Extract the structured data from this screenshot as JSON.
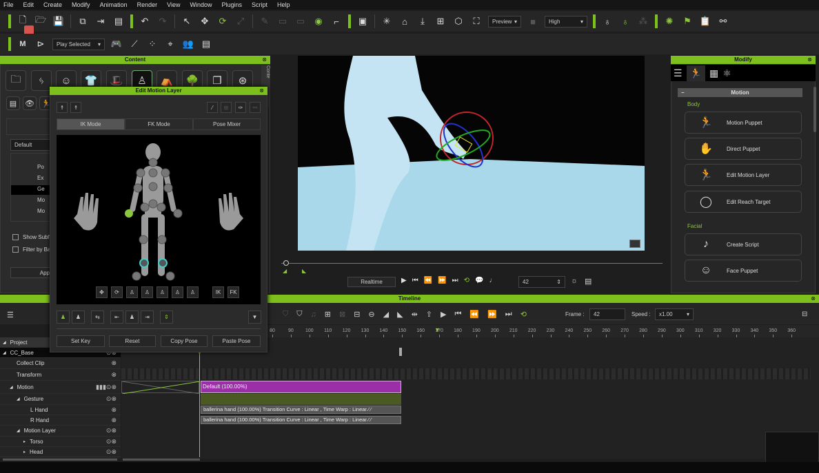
{
  "menu": [
    "File",
    "Edit",
    "Create",
    "Modify",
    "Animation",
    "Render",
    "View",
    "Window",
    "Plugins",
    "Script",
    "Help"
  ],
  "toolbar": {
    "play_mode": "Play Selected",
    "render_mode": "Preview",
    "quality": "High"
  },
  "content": {
    "title": "Content",
    "side_tab": "Conte",
    "filter": "Default",
    "tree": [
      "Po",
      "Ex",
      "Ge",
      "Mo",
      "Mo"
    ],
    "show_subfolder": "Show Subf",
    "filter_by": "Filter by Ba",
    "apply": "App"
  },
  "dialog": {
    "title": "Edit Motion Layer",
    "tabs": [
      "IK Mode",
      "FK Mode",
      "Pose Mixer"
    ],
    "active_tab": "IK Mode",
    "ik": "IK",
    "fk": "FK",
    "buttons": [
      "Set Key",
      "Reset",
      "Copy Pose",
      "Paste Pose"
    ]
  },
  "playback": {
    "realtime": "Realtime",
    "frame": "42"
  },
  "modify": {
    "title": "Modify",
    "section": "Motion",
    "body_label": "Body",
    "facial_label": "Facial",
    "body_items": [
      "Motion Puppet",
      "Direct Puppet",
      "Edit Motion Layer",
      "Edit Reach Target"
    ],
    "facial_items": [
      "Create Script",
      "Face Puppet"
    ]
  },
  "timeline": {
    "title": "Timeline",
    "frame_label": "Frame :",
    "frame": "42",
    "speed_label": "Speed :",
    "speed": "x1.00",
    "ruler": [
      80,
      90,
      100,
      110,
      120,
      130,
      140,
      150,
      160,
      170,
      180,
      190,
      200,
      210,
      220,
      230,
      240,
      250,
      260,
      270,
      280,
      290,
      300,
      310,
      320,
      330,
      340,
      350,
      360
    ],
    "tracks": [
      "Project",
      "CC_Base",
      "Collect Clip",
      "Transform",
      "Motion",
      "Gesture",
      "L Hand",
      "R Hand",
      "Motion Layer",
      "Torso",
      "Head"
    ],
    "motion_clip": "Default (100.00%)",
    "l_hand_clip": "ballerina hand (100.00%) Transition Curve : Linear , Time Warp : Linear",
    "r_hand_clip": "ballerina hand (100.00%) Transition Curve : Linear , Time Warp : Linear"
  },
  "colors": {
    "accent": "#7dbf1c",
    "motion_clip": "#9b2fa8",
    "gesture_track": "#4b5a22"
  }
}
